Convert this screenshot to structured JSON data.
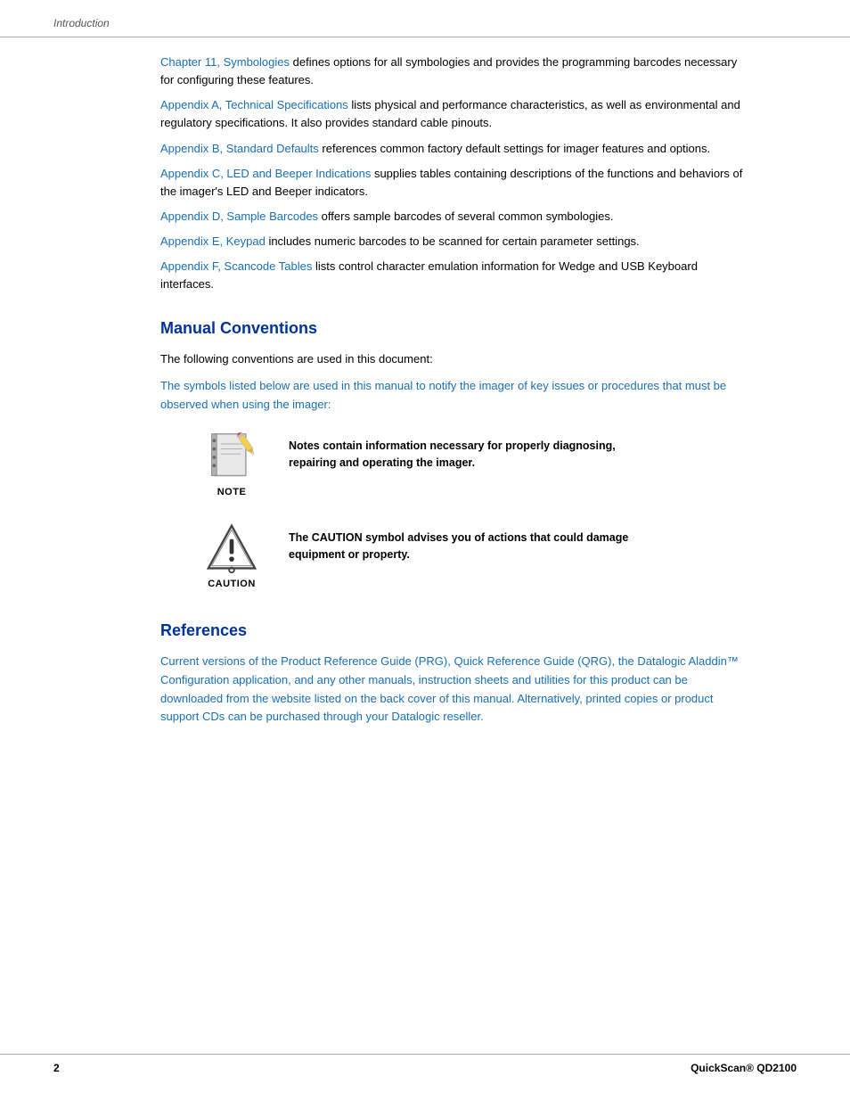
{
  "header": {
    "breadcrumb": "Introduction"
  },
  "toc_items": [
    {
      "link": "Chapter 11, Symbologies",
      "text": " defines options for all symbologies and provides the programming barcodes necessary for configuring these features."
    },
    {
      "link": "Appendix A, Technical Specifications",
      "text": " lists physical and performance characteristics, as well as environmental and regulatory specifications. It also provides standard cable pinouts."
    },
    {
      "link": "Appendix B, Standard Defaults",
      "text": " references common factory default settings for imager features and options."
    },
    {
      "link": "Appendix C, LED and Beeper Indications",
      "text": " supplies tables containing descriptions of the functions and behaviors of the imager’s LED and Beeper indicators."
    },
    {
      "link": "Appendix D, Sample Barcodes",
      "text": " offers sample barcodes of several common symbologies."
    },
    {
      "link": "Appendix E, Keypad",
      "text": " includes numeric barcodes to be scanned for certain parameter settings."
    },
    {
      "link": "Appendix F, Scancode Tables",
      "text": " lists control character emulation information for Wedge and USB Keyboard interfaces."
    }
  ],
  "manual_conventions": {
    "heading": "Manual Conventions",
    "intro": "The following conventions are used in this document:",
    "symbols_text": "The symbols listed below are used in this manual to notify the imager of key  issues or procedures that must be observed when using the imager:",
    "note": {
      "label": "NOTE",
      "text": "Notes contain information necessary for properly diagnosing, repairing and operating the imager."
    },
    "caution": {
      "label": "CAUTION",
      "text": "The CAUTION symbol advises you of actions that could damage equipment or property."
    }
  },
  "references": {
    "heading": "References",
    "text": "Current versions of the Product Reference Guide (PRG), Quick Reference Guide (QRG), the Datalogic Aladdin™ Configuration application, and any other manuals, instruction sheets and utilities for this product can be downloaded from the website listed on the back cover of this manual. Alternatively, printed copies or product support CDs can be purchased through your Datalogic reseller."
  },
  "footer": {
    "page": "2",
    "product": "QuickScan® QD2100"
  }
}
